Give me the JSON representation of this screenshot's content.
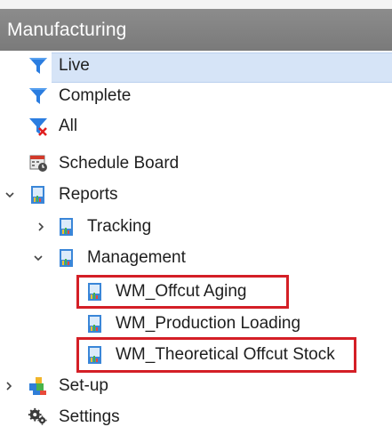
{
  "panel": {
    "title": "Manufacturing"
  },
  "tree": {
    "live": {
      "label": "Live",
      "icon": "funnel-icon"
    },
    "complete": {
      "label": "Complete",
      "icon": "funnel-icon"
    },
    "all": {
      "label": "All",
      "icon": "funnel-clear-icon"
    },
    "schedule_board": {
      "label": "Schedule Board",
      "icon": "calendar-icon"
    },
    "reports": {
      "label": "Reports",
      "icon": "report-icon"
    },
    "tracking": {
      "label": "Tracking",
      "icon": "report-icon"
    },
    "management": {
      "label": "Management",
      "icon": "report-icon"
    },
    "offcut_aging": {
      "label": "WM_Offcut Aging",
      "icon": "report-icon"
    },
    "production_loading": {
      "label": "WM_Production Loading",
      "icon": "report-icon"
    },
    "theoretical_offcut": {
      "label": "WM_Theoretical Offcut Stock",
      "icon": "report-icon"
    },
    "setup": {
      "label": "Set-up",
      "icon": "blocks-icon"
    },
    "settings": {
      "label": "Settings",
      "icon": "gears-icon"
    }
  },
  "colors": {
    "highlight_box": "#d41f26",
    "selection": "#d6e4f7",
    "header": "#808080"
  }
}
